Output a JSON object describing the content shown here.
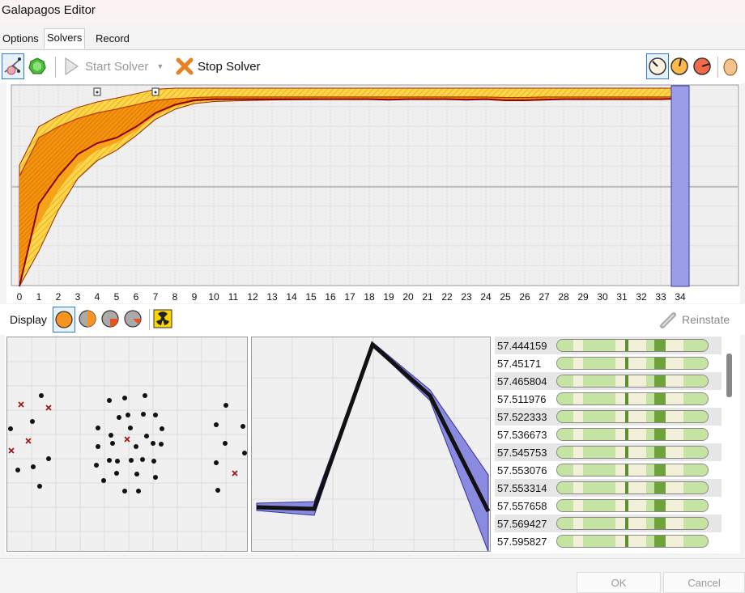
{
  "window": {
    "title": "Galapagos Editor"
  },
  "tabs": [
    {
      "label": "Options",
      "active": false
    },
    {
      "label": "Solvers",
      "active": true
    },
    {
      "label": "Record",
      "active": false
    }
  ],
  "toolbar": {
    "start_label": "Start Solver",
    "stop_label": "Stop Solver",
    "solver_icons": [
      "evolutionary-solver-icon",
      "annealing-solver-icon"
    ],
    "speed_icons": [
      "gauge-slow-icon",
      "gauge-medium-icon",
      "gauge-fast-icon"
    ],
    "extra_icon": "egg-icon"
  },
  "display": {
    "label": "Display",
    "reinstate_label": "Reinstate",
    "icons": [
      "orange-ball-icon",
      "grey-orange-ball-icon",
      "grey-red-ball-icon",
      "grey-ball-icon",
      "radiation-icon"
    ],
    "accent": "#2b7cd3"
  },
  "chart_data": {
    "type": "area",
    "categories": [
      "0",
      "1",
      "2",
      "3",
      "4",
      "5",
      "6",
      "7",
      "8",
      "9",
      "10",
      "11",
      "12",
      "13",
      "14",
      "15",
      "16",
      "17",
      "18",
      "19",
      "20",
      "21",
      "22",
      "23",
      "24",
      "25",
      "26",
      "27",
      "28",
      "29",
      "30",
      "31",
      "32",
      "33",
      "34"
    ],
    "series": [
      {
        "values": [
          57.4,
          57.47,
          57.49,
          57.505,
          57.515,
          57.522,
          57.53,
          57.538,
          57.541,
          57.543,
          57.544,
          57.544,
          57.544,
          57.544,
          57.544,
          57.544,
          57.544,
          57.544,
          57.544,
          57.544,
          57.544,
          57.544,
          57.544,
          57.544,
          57.544,
          57.543,
          57.543,
          57.544,
          57.544,
          57.544,
          57.544,
          57.544,
          57.544,
          57.544,
          57.544
        ]
      },
      {
        "values": [
          57.2,
          57.35,
          57.4,
          57.44,
          57.46,
          57.47,
          57.49,
          57.515,
          57.53,
          57.538,
          57.54,
          57.54,
          57.54,
          57.54,
          57.54,
          57.54,
          57.54,
          57.54,
          57.54,
          57.539,
          57.54,
          57.54,
          57.54,
          57.539,
          57.54,
          57.538,
          57.538,
          57.539,
          57.54,
          57.54,
          57.54,
          57.54,
          57.54,
          57.54,
          57.541
        ]
      }
    ],
    "ylim": [
      57.2,
      57.56
    ],
    "highlight_category": "34",
    "marker_generations": [
      "4",
      "7"
    ],
    "colors": {
      "best": "#8b0000",
      "band": "#ffa500",
      "highlight": "#9a9ee8"
    }
  },
  "genomes": [
    {
      "fitness": "57.444159"
    },
    {
      "fitness": "57.45171"
    },
    {
      "fitness": "57.465804"
    },
    {
      "fitness": "57.511976"
    },
    {
      "fitness": "57.522333"
    },
    {
      "fitness": "57.536673"
    },
    {
      "fitness": "57.545753"
    },
    {
      "fitness": "57.553076"
    },
    {
      "fitness": "57.553314"
    },
    {
      "fitness": "57.557658"
    },
    {
      "fitness": "57.569427"
    },
    {
      "fitness": "57.595827"
    }
  ],
  "dialog": {
    "ok_label": "OK",
    "cancel_label": "Cancel"
  }
}
